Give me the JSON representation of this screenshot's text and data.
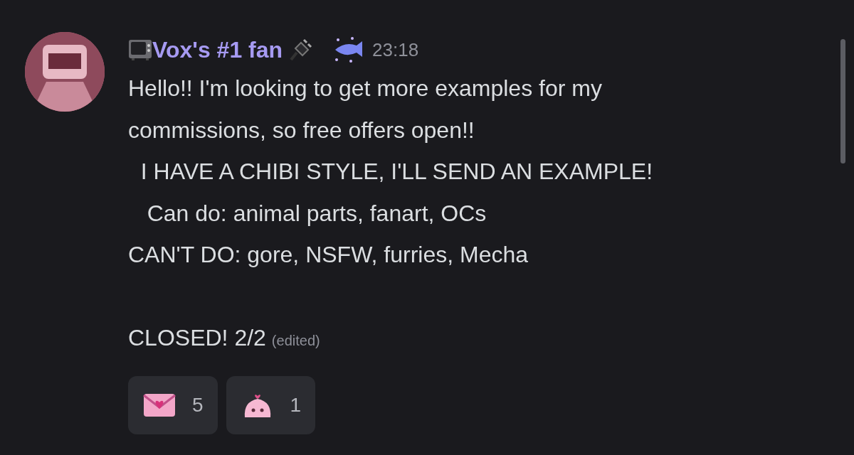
{
  "message": {
    "author": "Vox's #1 fan",
    "timestamp": "23:18",
    "paragraphs": [
      [
        "Hello!! I'm looking to get more examples for my",
        "commissions, so free offers open!!",
        "  I HAVE A CHIBI STYLE, I'LL SEND AN EXAMPLE!",
        "   Can do: animal parts, fanart, OCs",
        "CAN'T DO: gore, NSFW, furries, Mecha"
      ],
      [
        "CLOSED! 2/2"
      ]
    ],
    "edited": "(edited)",
    "reactions": [
      {
        "kind": "letter",
        "count": "5"
      },
      {
        "kind": "slime",
        "count": "1"
      }
    ]
  }
}
